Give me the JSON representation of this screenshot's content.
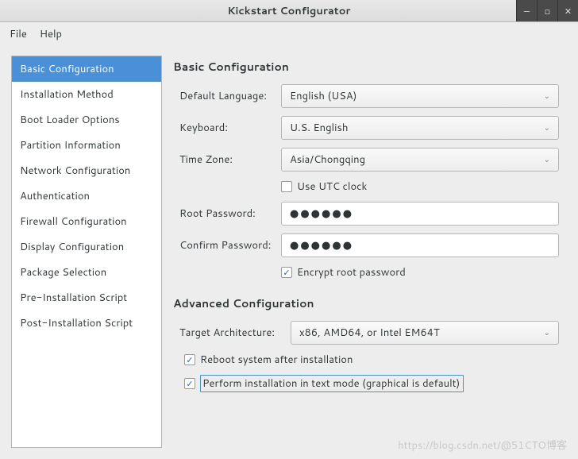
{
  "window": {
    "title": "Kickstart Configurator"
  },
  "menubar": {
    "file": "File",
    "help": "Help"
  },
  "sidebar": {
    "items": [
      "Basic Configuration",
      "Installation Method",
      "Boot Loader Options",
      "Partition Information",
      "Network Configuration",
      "Authentication",
      "Firewall Configuration",
      "Display Configuration",
      "Package Selection",
      "Pre-Installation Script",
      "Post-Installation Script"
    ],
    "selected_index": 0
  },
  "basic": {
    "title": "Basic Configuration",
    "labels": {
      "language": "Default Language:",
      "keyboard": "Keyboard:",
      "timezone": "Time Zone:",
      "root_password": "Root Password:",
      "confirm_password": "Confirm Password:"
    },
    "values": {
      "language": "English (USA)",
      "keyboard": "U.S. English",
      "timezone": "Asia/Chongqing",
      "root_password_masked": "●●●●●●",
      "confirm_password_masked": "●●●●●●"
    },
    "checkboxes": {
      "utc_label": "Use UTC clock",
      "utc_checked": false,
      "encrypt_label": "Encrypt root password",
      "encrypt_checked": true
    }
  },
  "advanced": {
    "title": "Advanced Configuration",
    "labels": {
      "target_arch": "Target Architecture:"
    },
    "values": {
      "target_arch": "x86, AMD64, or Intel EM64T"
    },
    "checkboxes": {
      "reboot_label": "Reboot system after installation",
      "reboot_checked": true,
      "textmode_label": "Perform installation in text mode (graphical is default)",
      "textmode_checked": true
    }
  },
  "watermark": "https://blog.csdn.net/@51CTO博客"
}
